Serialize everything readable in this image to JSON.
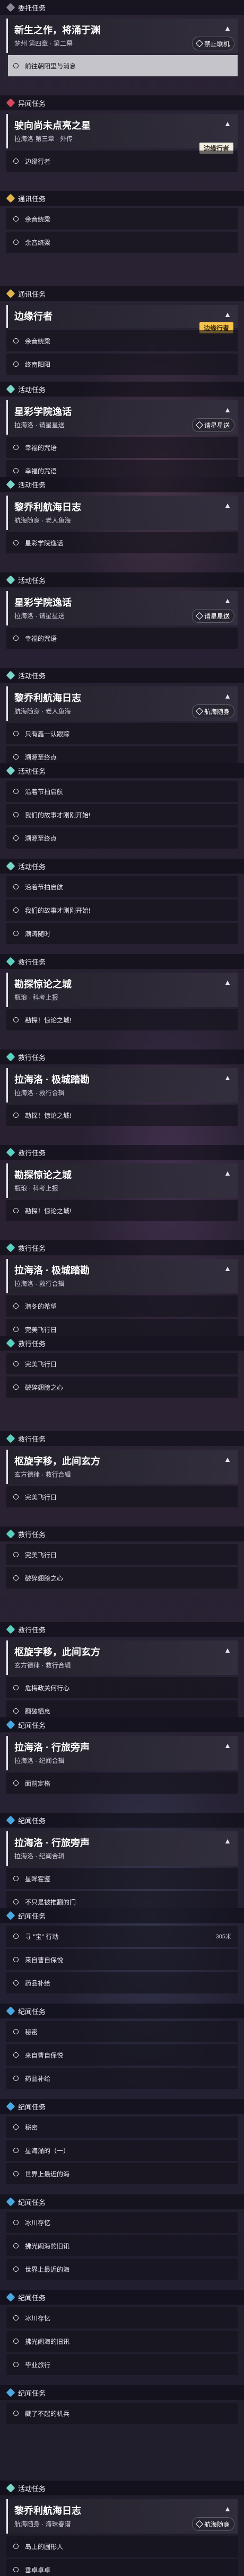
{
  "blocks": [
    {
      "header": {
        "label": "委托任务",
        "color": "#8c8596"
      },
      "quest": {
        "title": "新生之作，将涌于渊",
        "sub": "梦州 第四章 · 第二幕",
        "chip": "禁止联机"
      },
      "steps": [
        {
          "label": "前往朝阳里与消息",
          "active": true
        }
      ]
    },
    {
      "header": {
        "label": "异闻任务",
        "color": "#d04a5c"
      },
      "quest": {
        "title": "驶向尚未点亮之星",
        "sub": "拉海洛 第三章 · 外传",
        "tag": "边缘行者",
        "tagOrange": false
      },
      "steps": [
        {
          "label": "边缘行者",
          "active": false
        }
      ]
    },
    {
      "header": {
        "label": "通讯任务",
        "color": "#e0b448"
      },
      "steps": [
        {
          "label": "余音绕梁",
          "active": false
        },
        {
          "label": "余音绕梁",
          "active": false
        }
      ]
    },
    {
      "header": {
        "label": "通讯任务",
        "color": "#e0b448"
      },
      "quest": {
        "title": "边缘行者",
        "sub": "",
        "tag": "边缘行者",
        "tagOrange": true
      },
      "steps": [
        {
          "label": "余音绕梁",
          "active": false
        },
        {
          "label": "终南阳阳",
          "active": false
        }
      ]
    },
    {
      "header": {
        "label": "活动任务",
        "color": "#7ad6c8"
      },
      "quest": {
        "title": "星彩学院逸话",
        "sub": "拉海洛 · 请星星送",
        "chip": "请星星送"
      },
      "steps": [
        {
          "label": "幸福的咒语",
          "active": false
        },
        {
          "label": "幸福的咒语",
          "active": false
        }
      ]
    },
    {
      "header": {
        "label": "活动任务",
        "color": "#7ad6c8"
      },
      "quest": {
        "title": "黎乔利航海日志",
        "sub": "航海随身 · 老人鱼海",
        "chip": ""
      },
      "steps": [
        {
          "label": "星彩学院逸话",
          "active": false
        }
      ]
    },
    {
      "header": {
        "label": "活动任务",
        "color": "#7ad6c8"
      },
      "quest": {
        "title": "星彩学院逸话",
        "sub": "拉海洛 · 请星星送",
        "chip": "请星星送"
      },
      "steps": [
        {
          "label": "幸福的咒语",
          "active": false
        }
      ]
    },
    {
      "header": {
        "label": "活动任务",
        "color": "#7ad6c8"
      },
      "quest": {
        "title": "黎乔利航海日志",
        "sub": "航海随身 · 老人鱼海",
        "chip": "航海随身"
      },
      "steps": [
        {
          "label": "只有鑫一认跟踪",
          "active": false
        },
        {
          "label": "溯源至终点",
          "active": false
        }
      ]
    },
    {
      "header": {
        "label": "活动任务",
        "color": "#7ad6c8"
      },
      "steps": [
        {
          "label": "沿着节拍启航",
          "active": false
        },
        {
          "label": "我们的故事才刚刚开始!",
          "active": false
        },
        {
          "label": "溯源至终点",
          "active": false
        }
      ]
    },
    {
      "header": {
        "label": "活动任务",
        "color": "#7ad6c8"
      },
      "steps": [
        {
          "label": "沿着节拍启航",
          "active": false
        },
        {
          "label": "我们的故事才刚刚开始!",
          "active": false
        },
        {
          "label": "潮涛随时",
          "active": false
        }
      ]
    },
    {
      "header": {
        "label": "救行任务",
        "color": "#59d0c0"
      },
      "quest": {
        "title": "勘探惊论之城",
        "sub": "瓶琅 · 科考上报"
      },
      "steps": [
        {
          "label": "勘探！惊论之城!",
          "active": false
        }
      ]
    },
    {
      "header": {
        "label": "救行任务",
        "color": "#59d0c0"
      },
      "quest": {
        "title": "拉海洛 · 极城踏勘",
        "sub": "拉海洛 · 救行合辑"
      },
      "steps": [
        {
          "label": "勘探！惊论之城!",
          "active": false
        }
      ]
    },
    {
      "header": {
        "label": "救行任务",
        "color": "#59d0c0"
      },
      "quest": {
        "title": "勘探惊论之城",
        "sub": "瓶琅 · 科考上报"
      },
      "steps": [
        {
          "label": "勘探！惊论之城!",
          "active": false
        }
      ]
    },
    {
      "header": {
        "label": "救行任务",
        "color": "#59d0c0"
      },
      "quest": {
        "title": "拉海洛 · 极城踏勘",
        "sub": "拉海洛 · 救行合辑"
      },
      "steps": [
        {
          "label": "潜冬的希望",
          "active": false
        },
        {
          "label": "完美飞行日",
          "active": false
        }
      ]
    },
    {
      "header": {
        "label": "救行任务",
        "color": "#59d0c0"
      },
      "steps": [
        {
          "label": "完美飞行日",
          "active": false
        },
        {
          "label": "破碎翅膀之心",
          "active": false
        }
      ]
    },
    {
      "header": {
        "label": "救行任务",
        "color": "#59d0c0"
      },
      "quest": {
        "title": "枢旋字移，此间玄方",
        "sub": "玄方德律 · 救行合辑"
      },
      "steps": [
        {
          "label": "完美飞行日",
          "active": false
        }
      ]
    },
    {
      "header": {
        "label": "救行任务",
        "color": "#59d0c0"
      },
      "steps": [
        {
          "label": "完美飞行日",
          "active": false
        },
        {
          "label": "破碎翅膀之心",
          "active": false
        }
      ]
    },
    {
      "header": {
        "label": "救行任务",
        "color": "#59d0c0"
      },
      "quest": {
        "title": "枢旋字移，此间玄方",
        "sub": "玄方德律 · 救行合辑"
      },
      "steps": [
        {
          "label": "危梅政关何行心",
          "active": false
        },
        {
          "label": "翻破牺息",
          "active": false
        }
      ]
    },
    {
      "header": {
        "label": "纪闻任务",
        "color": "#4aa8e0"
      },
      "quest": {
        "title": "拉海洛 · 行旅旁声",
        "sub": "拉海洛 · 纪闻合辑"
      },
      "steps": [
        {
          "label": "面前定格",
          "active": false
        }
      ]
    },
    {
      "header": {
        "label": "纪闻任务",
        "color": "#4aa8e0"
      },
      "quest": {
        "title": "拉海洛 · 行旅旁声",
        "sub": "拉海洛 · 纪闻合辑"
      },
      "steps": [
        {
          "label": "星眸霍鉴",
          "active": false
        },
        {
          "label": "不只是被推翻的门",
          "active": false
        }
      ]
    },
    {
      "header": {
        "label": "纪闻任务",
        "color": "#4aa8e0"
      },
      "steps": [
        {
          "label": "寻 \"宝\" 行动",
          "active": false,
          "side": "305米"
        },
        {
          "label": "来自曹自保悦",
          "active": false
        },
        {
          "label": "药品补给",
          "active": false
        }
      ]
    },
    {
      "header": {
        "label": "纪闻任务",
        "color": "#4aa8e0"
      },
      "steps": [
        {
          "label": "秘密",
          "active": false
        },
        {
          "label": "来自曹自保悦",
          "active": false
        },
        {
          "label": "药品补给",
          "active": false
        }
      ]
    },
    {
      "header": {
        "label": "纪闻任务",
        "color": "#4aa8e0"
      },
      "steps": [
        {
          "label": "秘密",
          "active": false
        },
        {
          "label": "星海涌的（一）",
          "active": false
        },
        {
          "label": "世界上最近的海",
          "active": false
        }
      ]
    },
    {
      "header": {
        "label": "纪闻任务",
        "color": "#4aa8e0"
      },
      "steps": [
        {
          "label": "冰川存忆",
          "active": false
        },
        {
          "label": "拂光闹海的旧讯",
          "active": false
        },
        {
          "label": "世界上最近的海",
          "active": false
        }
      ]
    },
    {
      "header": {
        "label": "纪闻任务",
        "color": "#4aa8e0"
      },
      "steps": [
        {
          "label": "冰川存忆",
          "active": false
        },
        {
          "label": "拂光闹海的旧讯",
          "active": false
        },
        {
          "label": "毕业旅行",
          "active": false
        }
      ]
    },
    {
      "header": {
        "label": "纪闻任务",
        "color": "#4aa8e0"
      },
      "steps": [
        {
          "label": "藏了不起的机兵",
          "active": false
        }
      ]
    },
    {
      "header": {
        "label": "活动任务",
        "color": "#7ad6c8"
      },
      "quest": {
        "title": "黎乔利航海日志",
        "sub": "航海随身 · 海珠春谱",
        "chip": "航海随身"
      },
      "steps": [
        {
          "label": "岛上的圆形人",
          "active": false
        },
        {
          "label": "垂卓卓卓",
          "active": false
        }
      ]
    }
  ]
}
